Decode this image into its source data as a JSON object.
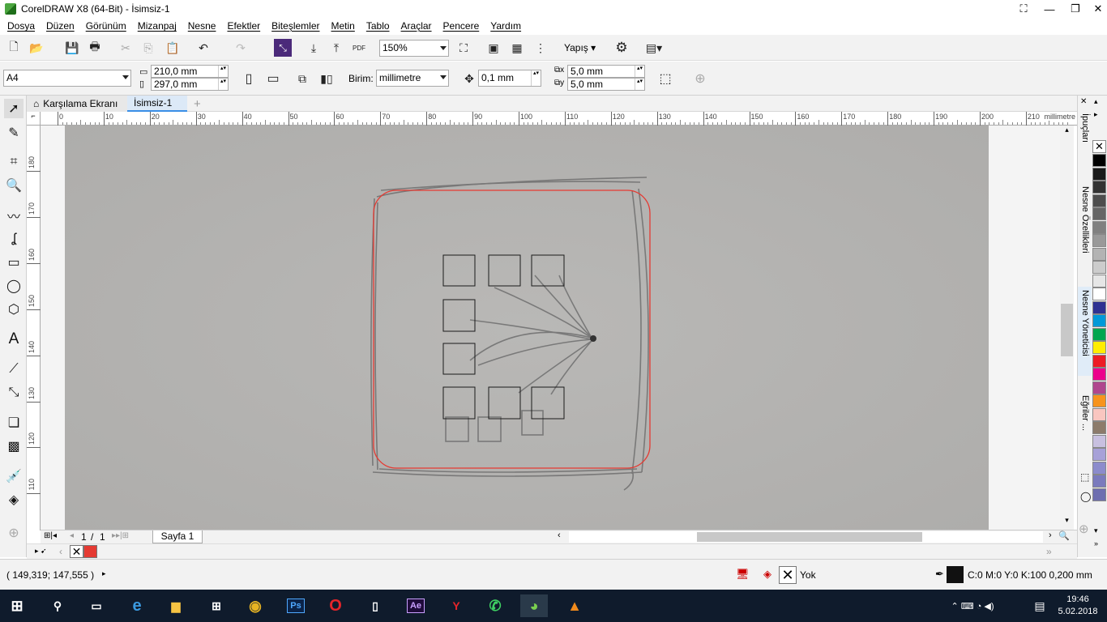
{
  "window": {
    "title": "CorelDRAW X8 (64-Bit) - İsimsiz-1"
  },
  "menu": [
    "Dosya",
    "Düzen",
    "Görünüm",
    "Mizanpaj",
    "Nesne",
    "Efektler",
    "Biteşlemler",
    "Metin",
    "Tablo",
    "Araçlar",
    "Pencere",
    "Yardım"
  ],
  "toolbar1": {
    "zoom": "150%",
    "snap_label": "Yapış"
  },
  "toolbar2": {
    "page_size": "A4",
    "width": "210,0 mm",
    "height": "297,0 mm",
    "unit_label": "Birim:",
    "unit_value": "millimetre",
    "nudge": "0,1 mm",
    "dup_x": "5,0 mm",
    "dup_y": "5,0 mm"
  },
  "tabs": {
    "welcome": "Karşılama Ekranı",
    "doc": "İsimsiz-1"
  },
  "ruler": {
    "h_ticks": [
      "0",
      "10",
      "20",
      "30",
      "40",
      "50",
      "60",
      "70",
      "80",
      "90",
      "100",
      "110",
      "120",
      "130",
      "140",
      "150",
      "160",
      "170",
      "180",
      "190",
      "200",
      "210"
    ],
    "h_unit": "millimetre",
    "v_ticks": [
      "180",
      "170",
      "160",
      "150",
      "140",
      "130",
      "120",
      "110"
    ]
  },
  "pagebar": {
    "current": "1",
    "sep": "/",
    "total": "1",
    "page_tab": "Sayfa 1"
  },
  "status": {
    "coords": "( 149,319; 147,555 )",
    "fill_label": "Yok",
    "outline_info": "C:0 M:0 Y:0 K:100  0,200 mm"
  },
  "dockers": [
    "İpuçları",
    "Nesne Özellikleri",
    "Nesne Yöneticisi",
    "Eğriler ..."
  ],
  "palette": [
    "#000000",
    "#1a1a1a",
    "#333333",
    "#4d4d4d",
    "#666666",
    "#808080",
    "#999999",
    "#b3b3b3",
    "#cccccc",
    "#e6e6e6",
    "#ffffff",
    "#2e3192",
    "#0099d8",
    "#00a650",
    "#ffed00",
    "#ed1c24",
    "#ec008c",
    "#b0468e",
    "#f7941d",
    "#f9c6c0",
    "#8c7b6b",
    "#c8c0e0",
    "#a7a1d8",
    "#8c8ccc",
    "#7b7bbd",
    "#6e6eb0"
  ],
  "clock": {
    "time": "19:46",
    "date": "5.02.2018"
  },
  "colors": {
    "accent_red": "#e53a32",
    "taskbar": "#0f1b2c"
  }
}
